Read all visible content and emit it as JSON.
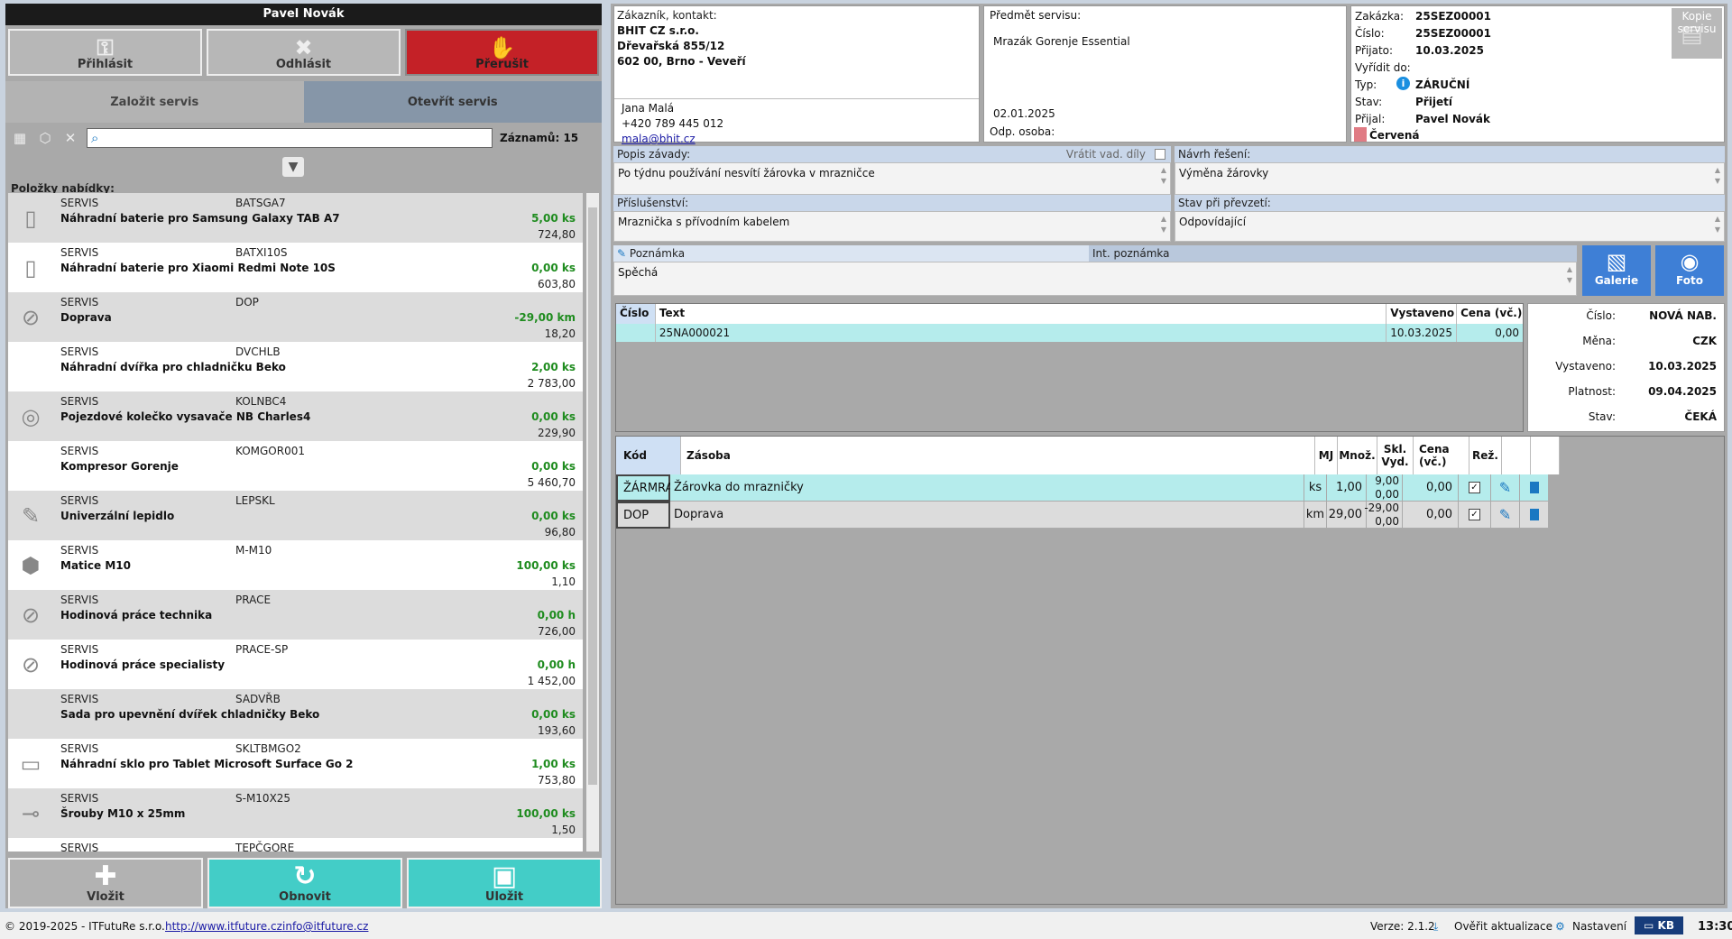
{
  "user": {
    "name": "Pavel Novák"
  },
  "top_buttons": {
    "login": "Přihlásit",
    "logout": "Odhlásit",
    "interrupt": "Přerušit"
  },
  "service_tabs": {
    "create": "Založit servis",
    "open": "Otevřít servis"
  },
  "search": {
    "placeholder": "",
    "value": "",
    "records_label": "Záznamů: 15"
  },
  "items_label": "Položky nabídky:",
  "items": [
    {
      "category": "SERVIS",
      "code": "BATSGA7",
      "name": "Náhradní baterie pro Samsung Galaxy TAB A7",
      "qty": "5,00 ks",
      "price": "724,80",
      "icon": "battery-icon"
    },
    {
      "category": "SERVIS",
      "code": "BATXI10S",
      "name": "Náhradní baterie pro Xiaomi Redmi Note 10S",
      "qty": "0,00 ks",
      "price": "603,80",
      "icon": "battery-icon"
    },
    {
      "category": "SERVIS",
      "code": "DOP",
      "name": "Doprava",
      "qty": "-29,00 km",
      "price": "18,20",
      "icon": "no-image-icon"
    },
    {
      "category": "SERVIS",
      "code": "DVCHLB",
      "name": "Náhradní dvířka pro chladničku Beko",
      "qty": "2,00 ks",
      "price": "2 783,00",
      "icon": ""
    },
    {
      "category": "SERVIS",
      "code": "KOLNBC4",
      "name": "Pojezdové kolečko vysavače NB Charles4",
      "qty": "0,00 ks",
      "price": "229,90",
      "icon": "wheel-icon"
    },
    {
      "category": "SERVIS",
      "code": "KOMGOR001",
      "name": "Kompresor Gorenje",
      "qty": "0,00 ks",
      "price": "5 460,70",
      "icon": ""
    },
    {
      "category": "SERVIS",
      "code": "LEPSKL",
      "name": "Univerzální lepidlo",
      "qty": "0,00 ks",
      "price": "96,80",
      "icon": "glue-icon"
    },
    {
      "category": "SERVIS",
      "code": "M-M10",
      "name": "Matice M10",
      "qty": "100,00 ks",
      "price": "1,10",
      "icon": "nut-icon"
    },
    {
      "category": "SERVIS",
      "code": "PRACE",
      "name": "Hodinová práce technika",
      "qty": "0,00 h",
      "price": "726,00",
      "icon": "no-image-icon"
    },
    {
      "category": "SERVIS",
      "code": "PRACE-SP",
      "name": "Hodinová práce specialisty",
      "qty": "0,00 h",
      "price": "1 452,00",
      "icon": "no-image-icon"
    },
    {
      "category": "SERVIS",
      "code": "SADVŘB",
      "name": "Sada pro upevnění dvířek chladničky Beko",
      "qty": "0,00 ks",
      "price": "193,60",
      "icon": ""
    },
    {
      "category": "SERVIS",
      "code": "SKLTBMGO2",
      "name": "Náhradní sklo pro Tablet Microsoft Surface Go 2",
      "qty": "1,00 ks",
      "price": "753,80",
      "icon": "glass-icon"
    },
    {
      "category": "SERVIS",
      "code": "S-M10X25",
      "name": "Šrouby M10 x 25mm",
      "qty": "100,00 ks",
      "price": "1,50",
      "icon": "screw-icon"
    },
    {
      "category": "SERVIS",
      "code": "TEPČGORE",
      "name": "",
      "qty": "",
      "price": "",
      "icon": ""
    }
  ],
  "bottom_buttons": {
    "insert": "Vložit",
    "refresh": "Obnovit",
    "save": "Uložit"
  },
  "customer": {
    "label": "Zákazník, kontakt:",
    "company": "BHIT CZ s.r.o.",
    "street": "Dřevařská 855/12",
    "city": "602 00, Brno - Veveří",
    "contact": "Jana Malá",
    "phone": "+420 789 445 012",
    "email": "mala@bhit.cz"
  },
  "subject": {
    "label": "Předmět servisu:",
    "value": "Mrazák Gorenje Essential",
    "date": "02.01.2025",
    "resp_label": "Odp. osoba:"
  },
  "order": {
    "order_label": "Zakázka:",
    "order_value": "25SEZ00001",
    "number_label": "Číslo:",
    "number_value": "25SEZ00001",
    "received_label": "Přijato:",
    "received_value": "10.03.2025",
    "due_label": "Vyřídit do:",
    "type_label": "Typ:",
    "type_value": "ZÁRUČNÍ",
    "state_label": "Stav:",
    "state_value": "Přijetí",
    "taken_label": "Přijal:",
    "taken_value": "Pavel Novák",
    "color_value": "Červená",
    "copy_label": "Kopie servisu"
  },
  "fault": {
    "label": "Popis závady:",
    "return_label": "Vrátit vad. díly",
    "value": "Po týdnu používání nesvítí žárovka v mrazničce"
  },
  "solution": {
    "label": "Návrh řešení:",
    "value": "Výměna žárovky"
  },
  "accessories": {
    "label": "Příslušenství:",
    "value": "Mraznička s přívodním kabelem"
  },
  "condition": {
    "label": "Stav při převzetí:",
    "value": "Odpovídající"
  },
  "note": {
    "label": "Poznámka",
    "int_label": "Int. poznámka",
    "value": "Spěchá"
  },
  "media": {
    "gallery": "Galerie",
    "photo": "Foto"
  },
  "offers": {
    "headers": {
      "number": "Číslo",
      "text": "Text",
      "issued": "Vystaveno",
      "price": "Cena (vč.)"
    },
    "rows": [
      {
        "number": "",
        "text": "25NA000021",
        "issued": "10.03.2025",
        "price": "0,00"
      }
    ]
  },
  "offer_info": {
    "number_label": "Číslo:",
    "number_value": "NOVÁ NAB.",
    "currency_label": "Měna:",
    "currency_value": "CZK",
    "issued_label": "Vystaveno:",
    "issued_value": "10.03.2025",
    "valid_label": "Platnost:",
    "valid_value": "09.04.2025",
    "state_label": "Stav:",
    "state_value": "ČEKÁ"
  },
  "parts": {
    "headers": {
      "code": "Kód",
      "stock": "Zásoba",
      "unit": "MJ",
      "qty": "Množ.",
      "sklvyd1": "Skl.",
      "sklvyd2": "Vyd.",
      "price1": "Cena",
      "price2": "(vč.)",
      "rez": "Rež."
    },
    "rows": [
      {
        "code": "ŽÁRMRA",
        "stock": "Žárovka do mrazničky",
        "unit": "ks",
        "qty": "1,00",
        "skl": "9,00",
        "vyd": "0,00",
        "price": "0,00"
      },
      {
        "code": "DOP",
        "stock": "Doprava",
        "unit": "km",
        "qty": "29,00",
        "skl": "-29,00",
        "vyd": "0,00",
        "price": "0,00"
      }
    ]
  },
  "status": {
    "copyright": "© 2019-2025 - ITFutuRe s.r.o.",
    "url": "http://www.itfuture.cz",
    "mail": "info@itfuture.cz",
    "version": "Verze: 2.1.2",
    "update": "Ověřit aktualizace",
    "settings": "Nastavení",
    "kb": "KB",
    "time": "13:30"
  },
  "colors": {
    "accent_teal": "#43cdc7",
    "danger": "#c42127",
    "qty_green": "#1f8c1f",
    "row_highlight": "#b5ecec",
    "blue": "#3e7fd6"
  }
}
